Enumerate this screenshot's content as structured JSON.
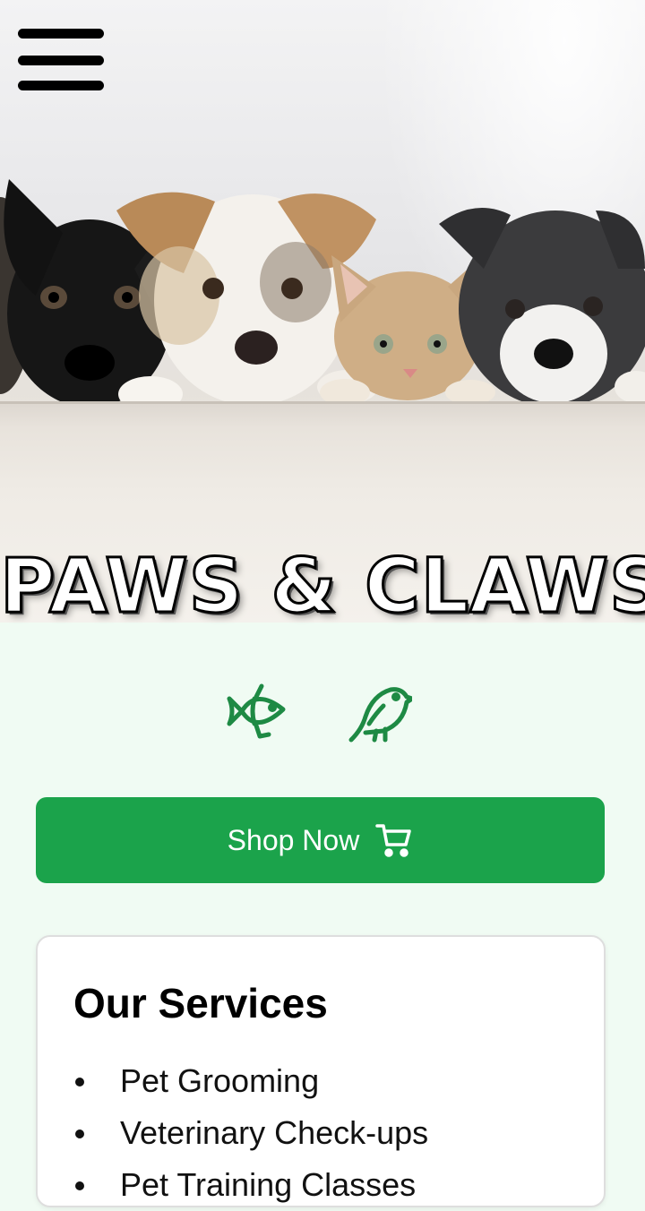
{
  "header": {
    "menu_icon": "hamburger-menu-icon"
  },
  "hero": {
    "image_subject": "puppies and kitten peeking over ledge",
    "title": "PAWS & CLAWS"
  },
  "pet_icons": [
    {
      "icon": "fish-icon"
    },
    {
      "icon": "bird-icon"
    }
  ],
  "cta": {
    "label": "Shop Now",
    "icon": "shopping-cart-icon"
  },
  "services": {
    "title": "Our Services",
    "items": [
      "Pet Grooming",
      "Veterinary Check-ups",
      "Pet Training Classes"
    ]
  },
  "colors": {
    "accent": "#1ba34b",
    "icon_green": "#1e8a44",
    "page_background": "#f0fbf3",
    "card_background": "#ffffff"
  }
}
